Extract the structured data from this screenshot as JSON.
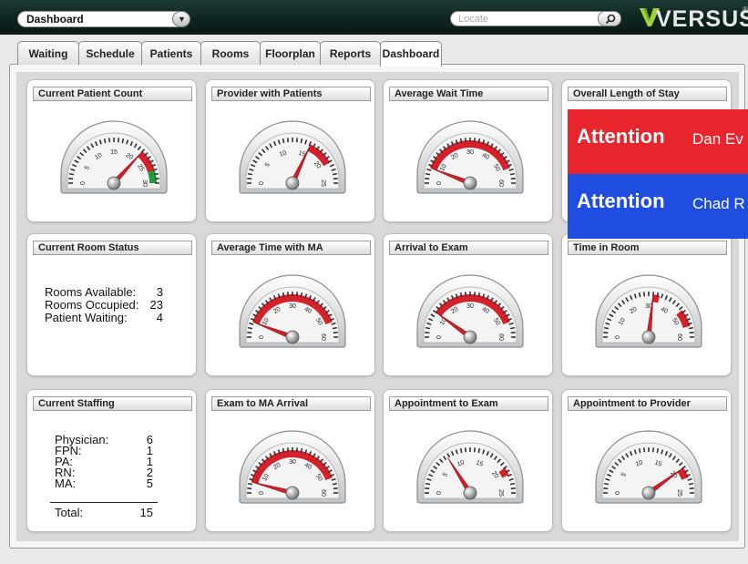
{
  "header": {
    "view_select": "Dashboard",
    "search_placeholder": "Locate",
    "logo": "VERSUS",
    "logo_mark": "®"
  },
  "tabs": [
    {
      "label": "Waiting"
    },
    {
      "label": "Schedule"
    },
    {
      "label": "Patients"
    },
    {
      "label": "Rooms"
    },
    {
      "label": "Floorplan"
    },
    {
      "label": "Reports"
    },
    {
      "label": "Dashboard",
      "active": true
    }
  ],
  "cards": {
    "patient_count": {
      "title": "Current Patient Count"
    },
    "provider_patients": {
      "title": "Provider with Patients"
    },
    "avg_wait": {
      "title": "Average Wait Time"
    },
    "length_of_stay": {
      "title": "Overall Length of Stay"
    },
    "room_status": {
      "title": "Current Room Status",
      "rows": [
        {
          "label": "Rooms Available:",
          "value": "3"
        },
        {
          "label": "Rooms Occupied:",
          "value": "23"
        },
        {
          "label": "Patient Waiting:",
          "value": "4"
        }
      ]
    },
    "time_with_ma": {
      "title": "Average Time with MA"
    },
    "arrival_exam": {
      "title": "Arrival to Exam"
    },
    "time_in_room": {
      "title": "Time in Room"
    },
    "staffing": {
      "title": "Current Staffing",
      "rows": [
        {
          "label": "Physician:",
          "value": "6"
        },
        {
          "label": "FPN:",
          "value": "1"
        },
        {
          "label": "PA:",
          "value": "1"
        },
        {
          "label": "RN:",
          "value": "2"
        },
        {
          "label": "MA:",
          "value": "5"
        }
      ],
      "total_label": "Total:",
      "total_value": "15"
    },
    "exam_ma_arrival": {
      "title": "Exam to MA Arrival"
    },
    "appt_exam": {
      "title": "Appointment to Exam"
    },
    "appt_provider": {
      "title": "Appointment to Provider"
    }
  },
  "gauges": {
    "patient_count": {
      "max": 30,
      "value": 22,
      "ticks": [
        "0",
        "5",
        "10",
        "15",
        "20",
        "25",
        "30"
      ],
      "zones": [
        {
          "from": 22,
          "to": 27,
          "color": "#d8202a"
        },
        {
          "from": 27,
          "to": 30,
          "color": "#1f9b3c"
        }
      ]
    },
    "provider_patients": {
      "max": 25,
      "value": 16,
      "ticks": [
        "0",
        "5",
        "10",
        "15",
        "20",
        "25"
      ],
      "zones": [
        {
          "from": 16,
          "to": 21,
          "color": "#d8202a"
        }
      ]
    },
    "avg_wait": {
      "max": 60,
      "value": 7,
      "ticks": [
        "0",
        "10",
        "20",
        "30",
        "40",
        "50",
        "60"
      ],
      "zones": [
        {
          "from": 7,
          "to": 53,
          "color": "#d8202a"
        }
      ]
    },
    "time_with_ma": {
      "max": 60,
      "value": 7,
      "ticks": [
        "0",
        "10",
        "20",
        "30",
        "40",
        "50",
        "60"
      ],
      "zones": [
        {
          "from": 7,
          "to": 53,
          "color": "#d8202a"
        }
      ]
    },
    "arrival_exam": {
      "max": 60,
      "value": 12,
      "ticks": [
        "0",
        "10",
        "20",
        "30",
        "40",
        "50",
        "60"
      ],
      "zones": [
        {
          "from": 12,
          "to": 53,
          "color": "#d8202a"
        }
      ]
    },
    "time_in_room": {
      "max": 60,
      "value": 32,
      "ticks": [
        "0",
        "10",
        "20",
        "30",
        "40",
        "50",
        "60"
      ],
      "zones": [
        {
          "from": 32,
          "to": 35,
          "color": "#d8202a"
        },
        {
          "from": 47,
          "to": 55,
          "color": "#d8202a"
        }
      ]
    },
    "exam_ma_arrival": {
      "max": 60,
      "value": 5,
      "ticks": [
        "0",
        "10",
        "20",
        "30",
        "40",
        "50",
        "60"
      ],
      "zones": [
        {
          "from": 5,
          "to": 53,
          "color": "#d8202a"
        }
      ]
    },
    "appt_exam": {
      "max": 25,
      "value": 8,
      "ticks": [
        "0",
        "5",
        "10",
        "15",
        "20",
        "25"
      ],
      "zones": [
        {
          "from": 20,
          "to": 21.5,
          "color": "#d8202a"
        }
      ]
    },
    "appt_provider": {
      "max": 25,
      "value": 20,
      "ticks": [
        "0",
        "5",
        "10",
        "15",
        "20",
        "25"
      ],
      "zones": [
        {
          "from": 20,
          "to": 22,
          "color": "#d8202a"
        }
      ]
    }
  },
  "alerts": [
    {
      "heading": "Attention",
      "name": "Dan Ev",
      "color": "#e8242c"
    },
    {
      "heading": "Attention",
      "name": "Chad R",
      "color": "#1e4de0"
    }
  ]
}
